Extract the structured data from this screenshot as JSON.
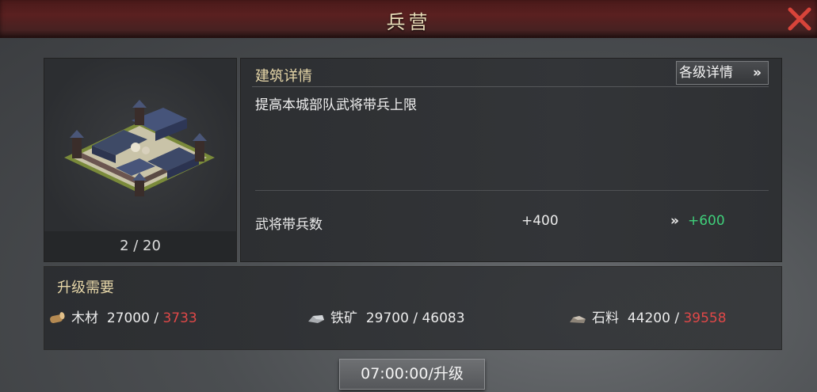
{
  "window": {
    "title": "兵营"
  },
  "building": {
    "level_text": "2 / 20"
  },
  "detail": {
    "header": "建筑详情",
    "levels_button": "各级详情",
    "levels_button_icon": "double-chevron-right-icon",
    "description": "提高本城部队武将带兵上限",
    "stat": {
      "label": "武将带兵数",
      "current": "+400",
      "arrow": "»",
      "next": "+600",
      "next_color": "#3fcf7a"
    }
  },
  "requirements": {
    "header": "升级需要",
    "resources": [
      {
        "name": "木材",
        "icon": "wood-log-icon",
        "required": "27000",
        "separator": "/",
        "owned": "3733",
        "owned_insufficient": true
      },
      {
        "name": "铁矿",
        "icon": "iron-ore-icon",
        "required": "29700",
        "separator": "/",
        "owned": "46083",
        "owned_insufficient": false
      },
      {
        "name": "石料",
        "icon": "stone-icon",
        "required": "44200",
        "separator": "/",
        "owned": "39558",
        "owned_insufficient": true
      }
    ]
  },
  "upgrade_button": {
    "label": "07:00:00/升级"
  },
  "colors": {
    "insufficient": "#e04848",
    "title_bar": "#5a2020",
    "close": "#d9443a"
  }
}
